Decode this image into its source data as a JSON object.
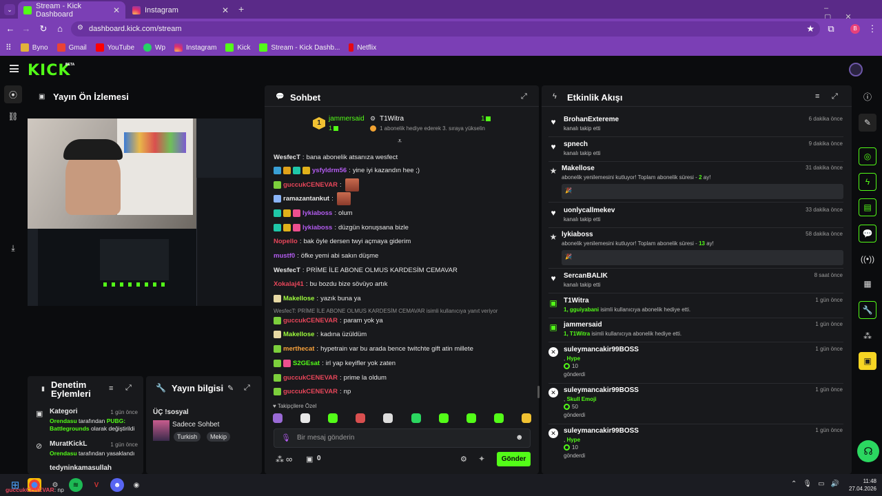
{
  "browser": {
    "tabs": [
      {
        "label": "Stream - Kick Dashboard"
      },
      {
        "label": "Instagram"
      }
    ],
    "url": "dashboard.kick.com/stream",
    "profile_initial": "B",
    "bookmarks": [
      "Byno",
      "Gmail",
      "YouTube",
      "Wp",
      "Instagram",
      "Kick",
      "Stream - Kick Dashb...",
      "Netflix"
    ]
  },
  "kick": {
    "logo": "KICK",
    "beta": "BETA"
  },
  "preview": {
    "title": "Yayın Ön İzlemesi"
  },
  "mod": {
    "title_line1": "Denetim",
    "title_line2": "Eylemleri",
    "entries": [
      {
        "name": "Kategori",
        "time": "1 gün önce",
        "line1_user": "Orendasu",
        "line1_rest": " tarafından ",
        "line1_tail": "PUBG:",
        "line2_tail": "Battlegrounds",
        "line2_rest": " olarak değiştirildi"
      },
      {
        "name": "MuratKickL",
        "time": "1 gün önce",
        "line1_user": "Orendasu",
        "line1_rest": " tarafından yasaklandı"
      },
      {
        "name": "tedyninkamasullah",
        "time": ""
      }
    ]
  },
  "info": {
    "title": "Yayın bilgisi",
    "stream_title": "ÜÇ !sosyal",
    "category": "Sadece Sohbet",
    "tags": [
      "Turkish",
      "Mekip"
    ]
  },
  "chat": {
    "title": "Sohbet",
    "pinned": {
      "left_user": "jammersaid",
      "left_count": "1",
      "right_user": "T1Witra",
      "right_count": "1",
      "right_msg": "1 abonelik hediye ederek 3. sıraya yükselin"
    },
    "messages": [
      {
        "user": "WesfecT",
        "cls": "u-white",
        "text": "bana abonelik atsanıza wesfect",
        "badges": []
      },
      {
        "user": "ysfyldrm56",
        "cls": "u-purple",
        "text": "yine iyi kazandın hee ;)",
        "badges": [
          "#3aa0d6",
          "#e0a21a",
          "#1fc7a8",
          "#e0b11a"
        ]
      },
      {
        "user": "guccukCENEVAR",
        "cls": "u-red",
        "text": "",
        "badges": [
          "#7ccf3c"
        ],
        "emote": true
      },
      {
        "user": "ramazantankut",
        "cls": "u-white",
        "text": "",
        "badges": [
          "#8ab4f8"
        ],
        "emote": true
      },
      {
        "user": "lykiaboss",
        "cls": "u-purple",
        "text": "olum",
        "badges": [
          "#1fc7a8",
          "#e0b11a",
          "#ec4f8e"
        ]
      },
      {
        "user": "lykiaboss",
        "cls": "u-purple",
        "text": "düzgün konuşsana bizle",
        "badges": [
          "#1fc7a8",
          "#e0b11a",
          "#ec4f8e"
        ]
      },
      {
        "user": "Nopello",
        "cls": "u-red",
        "text": "bak öyle dersen twyi açmaya giderim",
        "badges": []
      },
      {
        "user": "mustf0",
        "cls": "u-purple",
        "text": "öfke yemi abi sakın düşme",
        "badges": []
      },
      {
        "user": "WesfecT",
        "cls": "u-white",
        "text": "PRİME İLE ABONE OLMUS KARDESİM CEMAVAR",
        "badges": []
      },
      {
        "user": "Xokalaj41",
        "cls": "u-red",
        "text": "bu bozdu bize sövüyo artık",
        "badges": []
      },
      {
        "user": "Makellose",
        "cls": "u-lime",
        "text": "yazık buna ya",
        "badges": [
          "#e7d9a4"
        ]
      },
      {
        "reply": "WesfecT: PRİME İLE ABONE OLMUS KARDESİM CEMAVAR isimli kullanıcıya yanıt veriyor"
      },
      {
        "user": "guccukCENEVAR",
        "cls": "u-red",
        "text": "param yok ya",
        "badges": [
          "#7ccf3c"
        ]
      },
      {
        "user": "Makellose",
        "cls": "u-lime",
        "text": "kadına üzüldüm",
        "badges": [
          "#e7d9a4"
        ]
      },
      {
        "user": "merthecat",
        "cls": "u-orange",
        "text": "hypetrain var bu arada bence twitchte gift atin millete",
        "badges": [
          "#7ccf3c"
        ]
      },
      {
        "user": "S2GEsat",
        "cls": "u-green",
        "text": "irl yap keyifler yok zaten",
        "badges": [
          "#7ccf3c",
          "#ec4f8e"
        ]
      },
      {
        "user": "guccukCENEVAR",
        "cls": "u-red",
        "text": "prime la oldum",
        "badges": [
          "#7ccf3c"
        ]
      },
      {
        "user": "guccukCENEVAR",
        "cls": "u-red",
        "text": "np",
        "badges": [
          "#7ccf3c"
        ]
      }
    ],
    "followers_label": "Takipçilere Özel",
    "input_placeholder": "Bir mesaj gönderin",
    "send": "Gönder",
    "points": "∞",
    "gifts": "0"
  },
  "activity": {
    "title": "Etkinlik Akışı",
    "items": [
      {
        "type": "follow",
        "name": "BrohanExtereme",
        "time": "6 dakika önce",
        "desc": "kanalı takip etti"
      },
      {
        "type": "follow",
        "name": "spnech",
        "time": "9 dakika önce",
        "desc": "kanalı takip etti"
      },
      {
        "type": "resub",
        "name": "Makellose",
        "time": "31 dakika önce",
        "desc": "abonelik yenilemesini kutluyor! Toplam abonelik süresi - ",
        "months": "2",
        "unit": " ay!"
      },
      {
        "type": "follow",
        "name": "uonlycallmekev",
        "time": "33 dakika önce",
        "desc": "kanalı takip etti"
      },
      {
        "type": "resub",
        "name": "lykiaboss",
        "time": "58 dakika önce",
        "desc": "abonelik yenilemesini kutluyor! Toplam abonelik süresi - ",
        "months": "13",
        "unit": " ay!"
      },
      {
        "type": "follow",
        "name": "SercanBALIK",
        "time": "8 saat önce",
        "desc": "kanalı takip etti"
      },
      {
        "type": "gift",
        "name": "T1Witra",
        "time": "1 gün önce",
        "count": "1,",
        "who": "gguiyabani",
        "desc": " isimli kullanıcıya abonelik hediye etti."
      },
      {
        "type": "gift",
        "name": "jammersaid",
        "time": "1 gün önce",
        "count": "1,",
        "who": "T1Witra",
        "desc": " isimli kullanıcıya abonelik hediye etti."
      },
      {
        "type": "kicks",
        "name": "suleymancakir99BOSS",
        "time": "1 gün önce",
        "item": "Hype",
        "amount": "10",
        "desc": "gönderdi"
      },
      {
        "type": "kicks",
        "name": "suleymancakir99BOSS",
        "time": "1 gün önce",
        "item": "Skull Emoji",
        "amount": "50",
        "desc": "gönderdi"
      },
      {
        "type": "kicks",
        "name": "suleymancakir99BOSS",
        "time": "1 gün önce",
        "item": "Hype",
        "amount": "10",
        "desc": "gönderdi"
      }
    ]
  },
  "taskbar": {
    "time": "11:48",
    "date": "27.04.2026",
    "notif_user": "guccukCENEVAR",
    "notif_text": ": np"
  },
  "colors": {
    "brand": "#53fc18",
    "panel": "#18191c",
    "chrome": "#7b3fb5"
  }
}
